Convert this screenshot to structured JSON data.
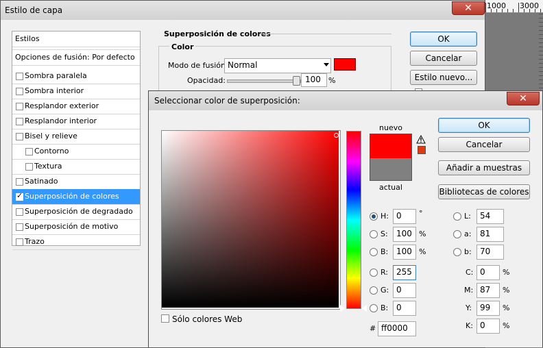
{
  "ruler": {
    "labels": [
      "1000",
      "3000"
    ]
  },
  "layer_style": {
    "title": "Estilo de capa",
    "close_glyph": "✕",
    "styles_header": "Estilos",
    "blend_options": "Opciones de fusión: Por defecto",
    "items": [
      {
        "label": "Sombra paralela",
        "checked": false
      },
      {
        "label": "Sombra interior",
        "checked": false
      },
      {
        "label": "Resplandor exterior",
        "checked": false
      },
      {
        "label": "Resplandor interior",
        "checked": false
      },
      {
        "label": "Bisel y relieve",
        "checked": false
      },
      {
        "label": "Contorno",
        "checked": false
      },
      {
        "label": "Textura",
        "checked": false
      },
      {
        "label": "Satinado",
        "checked": false
      },
      {
        "label": "Superposición de colores",
        "checked": true
      },
      {
        "label": "Superposición de degradado",
        "checked": false
      },
      {
        "label": "Superposición de motivo",
        "checked": false
      },
      {
        "label": "Trazo",
        "checked": false
      }
    ],
    "section_title": "Superposición de colores",
    "group_title": "Color",
    "blend_mode_label": "Modo de fusión:",
    "blend_mode_value": "Normal",
    "opacity_label": "Opacidad:",
    "opacity_value": "100",
    "opacity_unit": "%",
    "opacity_fraction": 1.0,
    "overlay_color": "#ff0000",
    "buttons": {
      "ok": "OK",
      "cancel": "Cancelar",
      "new_style": "Estilo nuevo..."
    }
  },
  "color_picker": {
    "title": "Seleccionar color de superposición:",
    "close_glyph": "✕",
    "new_label": "nuevo",
    "current_label": "actual",
    "new_color": "#ff0000",
    "current_color": "#808080",
    "web_only_label": "Sólo colores Web",
    "buttons": {
      "ok": "OK",
      "cancel": "Cancelar",
      "add_swatches": "Añadir a muestras",
      "color_libraries": "Bibliotecas de colores"
    },
    "hsb": {
      "H": {
        "label": "H:",
        "value": "0",
        "unit": "°",
        "selected": true
      },
      "S": {
        "label": "S:",
        "value": "100",
        "unit": "%"
      },
      "B": {
        "label": "B:",
        "value": "100",
        "unit": "%"
      }
    },
    "rgb": {
      "R": {
        "label": "R:",
        "value": "255"
      },
      "G": {
        "label": "G:",
        "value": "0"
      },
      "B": {
        "label": "B:",
        "value": "0"
      }
    },
    "lab": {
      "L": {
        "label": "L:",
        "value": "54"
      },
      "a": {
        "label": "a:",
        "value": "81"
      },
      "b": {
        "label": "b:",
        "value": "70"
      }
    },
    "cmyk": {
      "C": {
        "label": "C:",
        "value": "0",
        "unit": "%"
      },
      "M": {
        "label": "M:",
        "value": "87",
        "unit": "%"
      },
      "Y": {
        "label": "Y:",
        "value": "99",
        "unit": "%"
      },
      "K": {
        "label": "K:",
        "value": "0",
        "unit": "%"
      }
    },
    "hex_label": "#",
    "hex_value": "ff0000",
    "gamut_icon": "warning-triangle-icon",
    "field_hue_color": "#ff0000"
  }
}
